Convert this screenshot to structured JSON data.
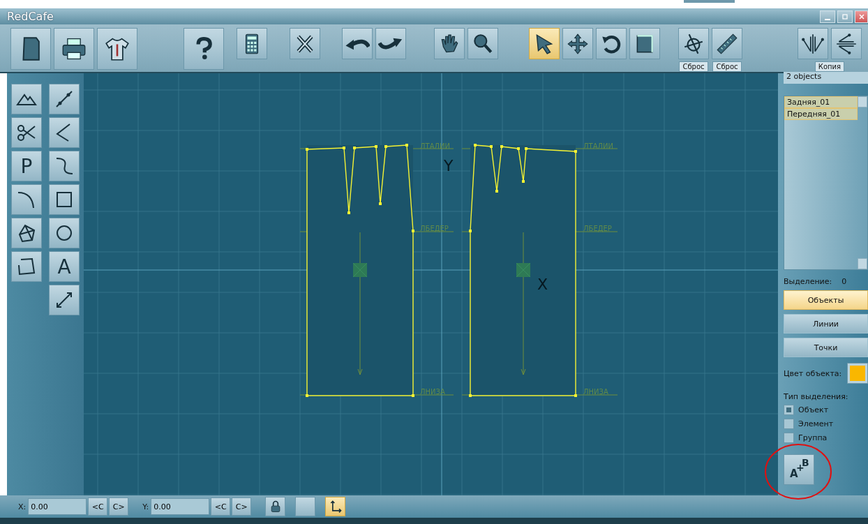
{
  "window": {
    "title": "RedCafe"
  },
  "toolbar": {
    "groups": [
      {
        "tools": [
          {
            "kind": "document",
            "selected": false
          },
          {
            "kind": "printer",
            "selected": false
          },
          {
            "kind": "shirt",
            "selected": false
          }
        ]
      },
      {
        "tools": [
          {
            "kind": "help",
            "selected": false
          }
        ]
      },
      {
        "tools": [
          {
            "kind": "calculator",
            "selected": false
          }
        ]
      },
      {
        "tools": [
          {
            "kind": "cross",
            "selected": false
          }
        ]
      },
      {
        "tools": [
          {
            "kind": "undo",
            "selected": false
          },
          {
            "kind": "redo",
            "selected": false
          }
        ]
      },
      {
        "tools": [
          {
            "kind": "hand",
            "selected": false
          },
          {
            "kind": "zoom",
            "selected": false
          }
        ]
      },
      {
        "tools": [
          {
            "kind": "pointer",
            "selected": true
          },
          {
            "kind": "move",
            "selected": false
          },
          {
            "kind": "rotate",
            "selected": false
          },
          {
            "kind": "resize",
            "selected": false
          }
        ]
      },
      {
        "tools": [
          {
            "kind": "compass",
            "selected": false,
            "caption": "Сброс"
          },
          {
            "kind": "ruler",
            "selected": false,
            "caption": "Сброс"
          }
        ]
      },
      {
        "tools": [
          {
            "kind": "mirror-vertical",
            "selected": false
          },
          {
            "kind": "mirror-horizontal",
            "selected": false
          }
        ],
        "caption": "Копия"
      }
    ]
  },
  "left_tools": {
    "columns": [
      [
        {
          "kind": "mountain"
        },
        {
          "kind": "scissors"
        },
        {
          "kind": "glyph",
          "glyph": "P"
        },
        {
          "kind": "corner-curve"
        },
        {
          "kind": "polygon-points"
        },
        {
          "kind": "open-polygon"
        }
      ],
      [
        {
          "kind": "line-points"
        },
        {
          "kind": "angle"
        },
        {
          "kind": "s-curve"
        },
        {
          "kind": "square"
        },
        {
          "kind": "circle"
        },
        {
          "kind": "glyph",
          "glyph": "A"
        },
        {
          "kind": "diagonal-arrow"
        }
      ]
    ]
  },
  "canvas": {
    "pieces": [
      {
        "waist_label": "ЛТАЛИИ",
        "hip_label": "ЛБЕДЕР",
        "hem_label": "ЛНИЗА"
      },
      {
        "waist_label": "ЛТАЛИИ",
        "hip_label": "ЛБЕДЕР",
        "hem_label": "ЛНИЗА"
      }
    ],
    "axis_labels": [
      "Y",
      "X"
    ]
  },
  "right_panel": {
    "count": "2 objects",
    "objects": [
      {
        "name": "Задняя_01",
        "selected": true
      },
      {
        "name": "Передняя_01",
        "selected": true
      }
    ],
    "selection_label": "Выделение:",
    "selection_count": "0",
    "tabs": [
      {
        "label": "Объекты",
        "selected": true
      },
      {
        "label": "Линии",
        "selected": false
      },
      {
        "label": "Точки",
        "selected": false
      }
    ],
    "color_label": "Цвет объекта:",
    "color": "#f9b700",
    "type_label": "Тип выделения:",
    "types": [
      {
        "label": "Объект",
        "checked": true
      },
      {
        "label": "Элемент",
        "checked": false
      },
      {
        "label": "Группа",
        "checked": false
      }
    ],
    "merge_button": {
      "from": "A",
      "sign": "+",
      "to": "B"
    }
  },
  "coords": [
    {
      "label": "X:",
      "value": "0.00",
      "prev": "<C",
      "next": "C>"
    },
    {
      "label": "Y:",
      "value": "0.00",
      "prev": "<C",
      "next": "C>"
    }
  ],
  "bottom_tools": [
    {
      "kind": "lock",
      "selected": false
    },
    {
      "kind": "blank",
      "selected": false
    },
    {
      "kind": "axes",
      "selected": true
    }
  ]
}
